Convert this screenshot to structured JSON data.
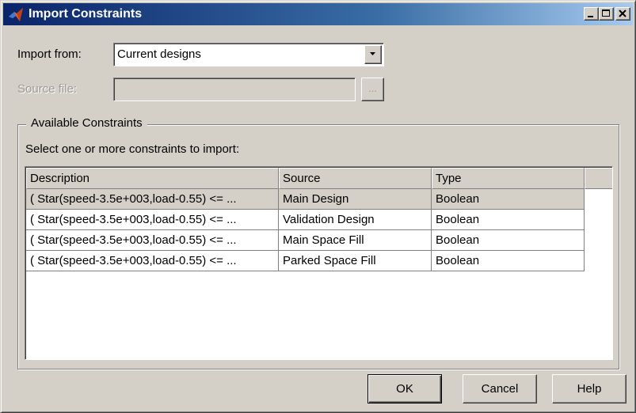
{
  "window": {
    "title": "Import Constraints",
    "icon": "matlab-logo-icon"
  },
  "import_from": {
    "label": "Import from:",
    "value": "Current designs"
  },
  "source_file": {
    "label": "Source file:",
    "value": "",
    "browse_label": "..."
  },
  "group": {
    "title": "Available Constraints",
    "instruction": "Select one or more constraints to import:"
  },
  "table": {
    "columns": [
      "Description",
      "Source",
      "Type",
      ""
    ],
    "rows": [
      {
        "description": "( Star(speed-3.5e+003,load-0.55) <= ...",
        "source": "Main Design",
        "type": "Boolean"
      },
      {
        "description": "( Star(speed-3.5e+003,load-0.55) <= ...",
        "source": "Validation Design",
        "type": "Boolean"
      },
      {
        "description": "( Star(speed-3.5e+003,load-0.55) <= ...",
        "source": "Main Space Fill",
        "type": "Boolean"
      },
      {
        "description": "( Star(speed-3.5e+003,load-0.55) <= ...",
        "source": "Parked Space Fill",
        "type": "Boolean"
      }
    ]
  },
  "buttons": {
    "ok": "OK",
    "cancel": "Cancel",
    "help": "Help"
  },
  "colors": {
    "title_bar_start": "#0a246a",
    "title_bar_end": "#a6caf0",
    "dialog_bg": "#d4d0c8"
  }
}
